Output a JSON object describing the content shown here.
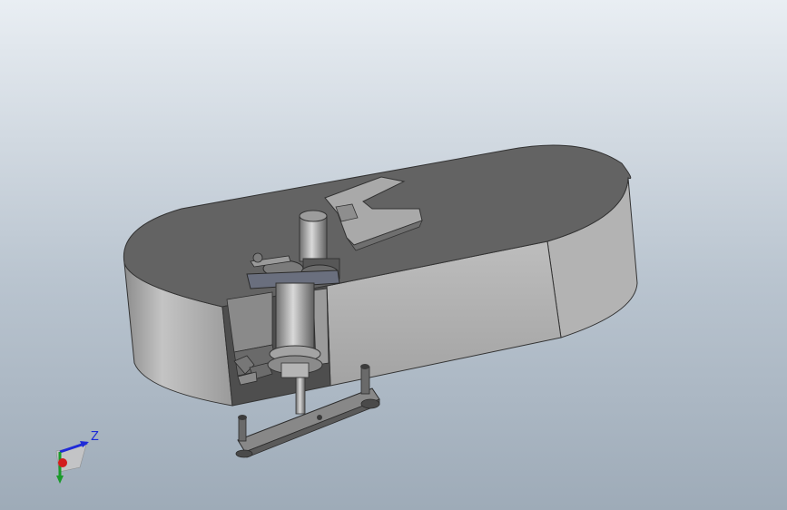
{
  "triad": {
    "z_label": "Z",
    "z_color": "#1f2ad8",
    "x_color": "#d21c1c",
    "y_color": "#1a9a2a"
  },
  "colors": {
    "bg_top": "#e9eef3",
    "bg_bottom": "#9eabb8",
    "enclosure_top": "#636363",
    "enclosure_side": "#a7a7a7"
  }
}
